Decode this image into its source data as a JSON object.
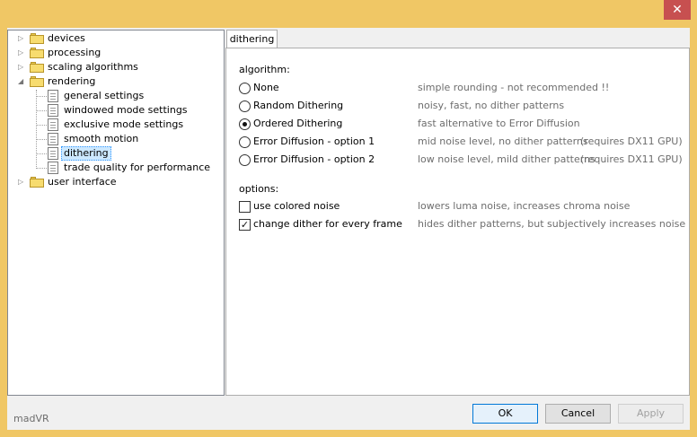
{
  "window": {
    "close_glyph": "✕"
  },
  "tree": {
    "items": [
      {
        "label": "devices",
        "icon": "folder-icon",
        "expander": "▷"
      },
      {
        "label": "processing",
        "icon": "folder-icon",
        "expander": "▷"
      },
      {
        "label": "scaling algorithms",
        "icon": "folder-icon",
        "expander": "▷"
      },
      {
        "label": "rendering",
        "icon": "folder-icon",
        "expander": "◢"
      },
      {
        "label": "general settings",
        "icon": "page-icon"
      },
      {
        "label": "windowed mode settings",
        "icon": "page-icon"
      },
      {
        "label": "exclusive mode settings",
        "icon": "page-icon"
      },
      {
        "label": "smooth motion",
        "icon": "page-icon"
      },
      {
        "label": "dithering",
        "icon": "page-icon",
        "selected": true
      },
      {
        "label": "trade quality for performance",
        "icon": "page-icon"
      },
      {
        "label": "user interface",
        "icon": "folder-icon",
        "expander": "▷"
      }
    ]
  },
  "tab": {
    "label": "dithering"
  },
  "algorithm": {
    "heading": "algorithm:",
    "options": [
      {
        "label": "None",
        "desc": "simple rounding - not recommended !!",
        "note": "",
        "checked": false
      },
      {
        "label": "Random Dithering",
        "desc": "noisy, fast, no dither patterns",
        "note": "",
        "checked": false
      },
      {
        "label": "Ordered Dithering",
        "desc": "fast alternative to Error Diffusion",
        "note": "",
        "checked": true
      },
      {
        "label": "Error Diffusion - option 1",
        "desc": "mid noise level, no dither patterns",
        "note": "(requires DX11 GPU)",
        "checked": false
      },
      {
        "label": "Error Diffusion - option 2",
        "desc": "low noise level, mild dither patterns",
        "note": "(requires DX11 GPU)",
        "checked": false
      }
    ]
  },
  "options": {
    "heading": "options:",
    "items": [
      {
        "label": "use colored noise",
        "desc": "lowers luma noise, increases chroma noise",
        "checked": false,
        "mark": ""
      },
      {
        "label": "change dither for every frame",
        "desc": "hides dither patterns, but subjectively increases noise",
        "checked": true,
        "mark": "✓"
      }
    ]
  },
  "footer": {
    "status": "madVR",
    "ok_label": "OK",
    "cancel_label": "Cancel",
    "apply_label": "Apply"
  }
}
